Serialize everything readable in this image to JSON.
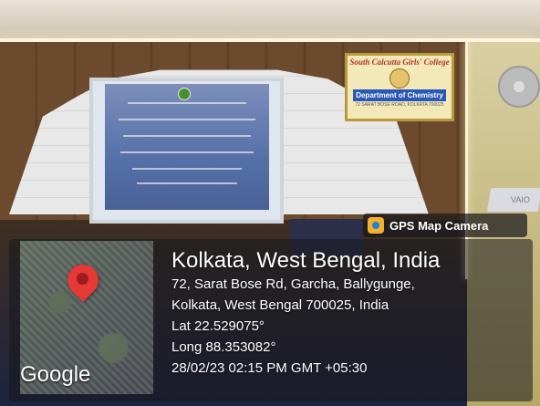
{
  "projector": {
    "slide_lines": [
      "South Calcutta Girls' College"
    ]
  },
  "sign": {
    "college": "South Calcutta Girls' College",
    "department": "Department of Chemistry",
    "address": "72 SARAT BOSE ROAD, KOLKATA 700025"
  },
  "laptop": {
    "brand": "VAIO"
  },
  "gps": {
    "app_title": "GPS Map Camera",
    "map_logo": "Google",
    "city_line": "Kolkata, West Bengal, India",
    "address_line1": "72, Sarat Bose Rd, Garcha, Ballygunge,",
    "address_line2": "Kolkata, West Bengal 700025, India",
    "lat": "Lat 22.529075°",
    "long": "Long 88.353082°",
    "datetime": "28/02/23 02:15 PM GMT +05:30"
  },
  "icons": {
    "gps_app": "gps-camera-icon",
    "map_pin": "location-pin-icon"
  },
  "colors": {
    "pin": "#e53935",
    "sign_band": "#2a58b8",
    "gps_icon": "#f3b02c"
  }
}
